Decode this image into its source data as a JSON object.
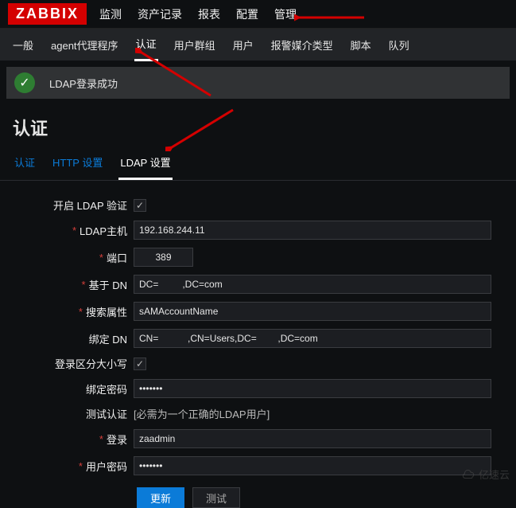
{
  "logo": "ZABBIX",
  "topnav": [
    "监测",
    "资产记录",
    "报表",
    "配置",
    "管理"
  ],
  "subnav": [
    "一般",
    "agent代理程序",
    "认证",
    "用户群组",
    "用户",
    "报警媒介类型",
    "脚本",
    "队列"
  ],
  "subnav_active": 2,
  "banner": {
    "icon": "✓",
    "text": "LDAP登录成功"
  },
  "page_title": "认证",
  "tabs": [
    "认证",
    "HTTP 设置",
    "LDAP 设置"
  ],
  "tabs_active": 2,
  "form": {
    "enable_label": "开启 LDAP 验证",
    "enable_checked": true,
    "host_label": "LDAP主机",
    "host_value": "192.168.244.11",
    "port_label": "端口",
    "port_value": "389",
    "basedn_label": "基于 DN",
    "basedn_value": "DC=         ,DC=com",
    "searchattr_label": "搜索属性",
    "searchattr_value": "sAMAccountName",
    "binddn_label": "绑定 DN",
    "binddn_value": "CN=           ,CN=Users,DC=        ,DC=com",
    "case_label": "登录区分大小写",
    "case_checked": true,
    "bindpw_label": "绑定密码",
    "bindpw_value": "•••••••",
    "test_label": "测试认证",
    "test_text": "[必需为一个正确的LDAP用户]",
    "login_label": "登录",
    "login_value": "zaadmin",
    "userpw_label": "用户密码",
    "userpw_value": "•••••••"
  },
  "buttons": {
    "update": "更新",
    "test": "测试"
  },
  "watermark": "亿速云"
}
